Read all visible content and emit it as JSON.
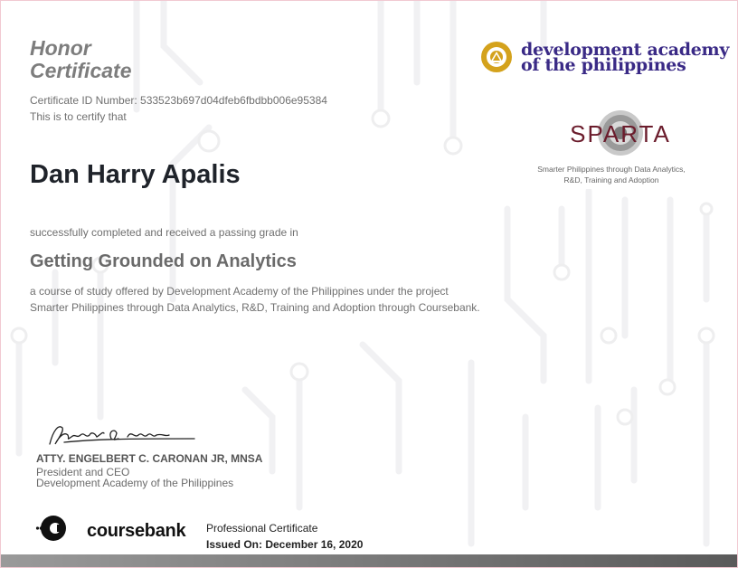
{
  "header": {
    "title_line1": "Honor",
    "title_line2": "Certificate",
    "certificate_id": "Certificate ID Number: 533523b697d04dfeb6fbdbb006e95384",
    "certify_text": "This is to certify that"
  },
  "recipient": {
    "name": "Dan Harry Apalis"
  },
  "body": {
    "completion_text": "successfully completed and received a passing grade in",
    "course_title": "Getting Grounded on Analytics",
    "description": "a course of study offered by Development Academy of the Philippines under the project Smarter Philippines through Data Analytics, R&D, Training and Adoption through Coursebank."
  },
  "signatory": {
    "name": "ATTY. ENGELBERT C. CARONAN JR, MNSA",
    "title": "President and CEO",
    "organization": "Development Academy of the Philippines"
  },
  "logos": {
    "dap_line1": "development academy",
    "dap_line2": "of the philippines",
    "sparta_name": "SPARTA",
    "sparta_tagline_line1": "Smarter Philippines through Data Analytics,",
    "sparta_tagline_line2": "R&D, Training and Adoption",
    "coursebank_name": "coursebank"
  },
  "footer": {
    "certificate_type": "Professional Certificate",
    "issued_on": "Issued On: December 16, 2020"
  },
  "colors": {
    "dap_purple": "#3a2a86",
    "dap_gold": "#d4a21c",
    "sparta_maroon": "#6b1c2c",
    "heading_gray": "#7d7d7d",
    "name_dark": "#1f232a",
    "footer_bar": "#707070"
  },
  "icons": [
    "dap-emblem-icon",
    "sparta-seal-icon",
    "coursebank-logo-icon",
    "signature-icon"
  ]
}
